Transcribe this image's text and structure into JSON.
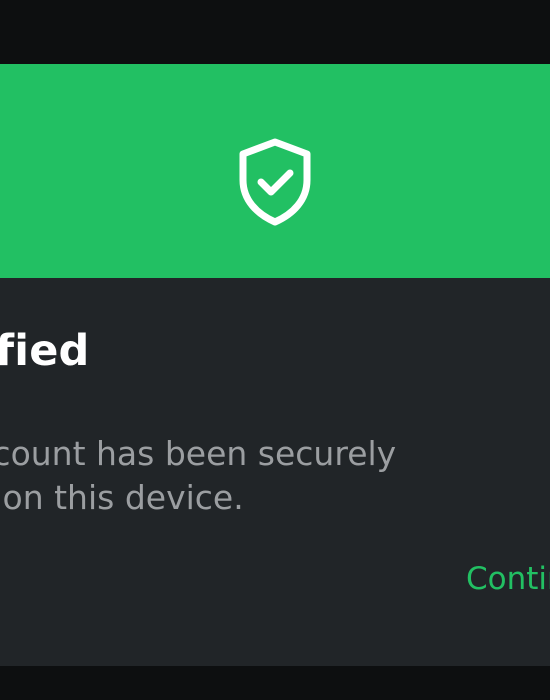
{
  "dialog": {
    "header_color": "#22c063",
    "icon": "shield-check-icon",
    "title": "rified",
    "message_lines": [
      "r account has been securely",
      "fied on this device."
    ],
    "action_label": "Contin"
  }
}
